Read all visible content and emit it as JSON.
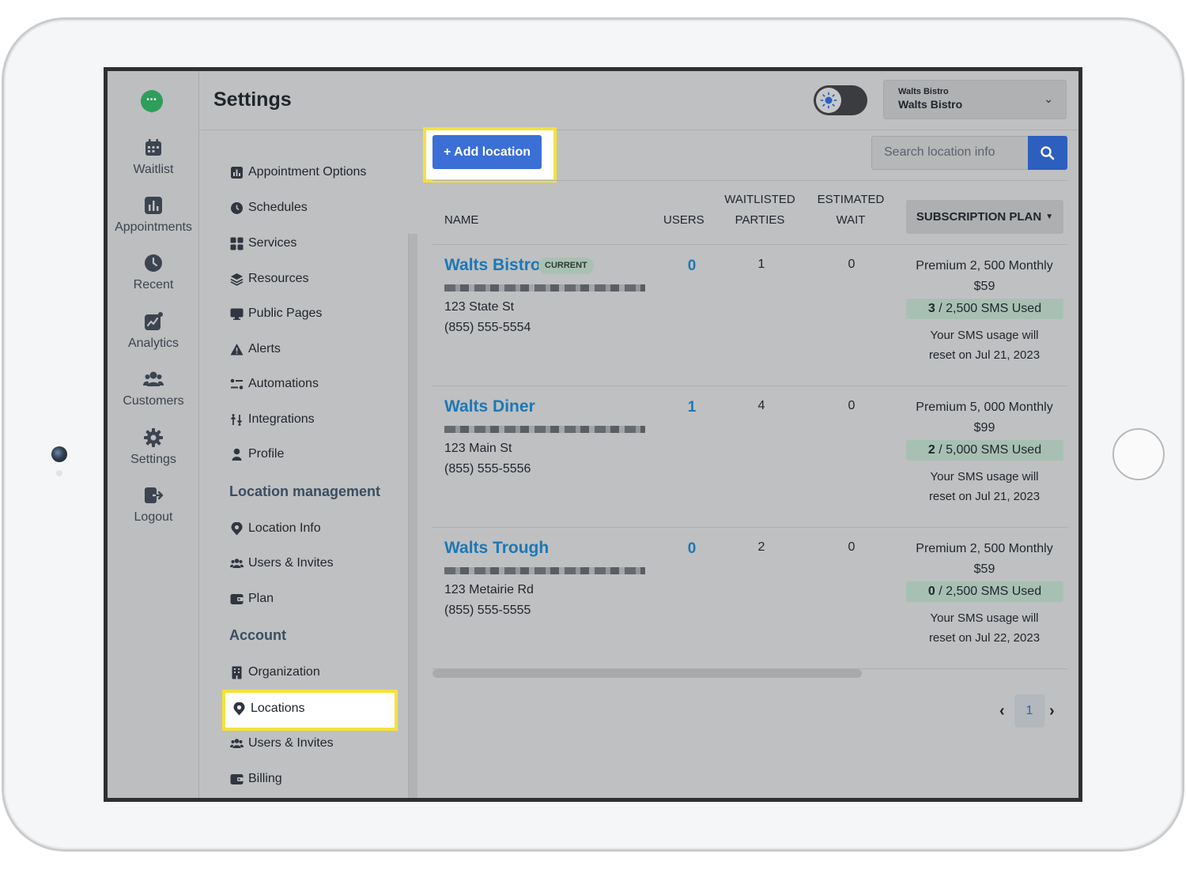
{
  "app": {
    "page_title": "Settings",
    "location_selector": {
      "line1": "Walts Bistro",
      "line2": "Walts Bistro"
    }
  },
  "rail": {
    "items": [
      {
        "label": "Waitlist",
        "icon": "calendar-icon"
      },
      {
        "label": "Appointments",
        "icon": "bar-chart-icon"
      },
      {
        "label": "Recent",
        "icon": "clock-icon"
      },
      {
        "label": "Analytics",
        "icon": "analytics-icon"
      },
      {
        "label": "Customers",
        "icon": "users-icon"
      },
      {
        "label": "Settings",
        "icon": "gear-icon"
      },
      {
        "label": "Logout",
        "icon": "logout-icon"
      }
    ]
  },
  "nav": {
    "items": [
      {
        "label": "Appointment Options",
        "icon": "bar-chart-icon"
      },
      {
        "label": "Schedules",
        "icon": "clock-icon"
      },
      {
        "label": "Services",
        "icon": "grid-icon"
      },
      {
        "label": "Resources",
        "icon": "layers-icon"
      },
      {
        "label": "Public Pages",
        "icon": "monitor-icon"
      },
      {
        "label": "Alerts",
        "icon": "warning-icon"
      },
      {
        "label": "Automations",
        "icon": "automation-icon"
      },
      {
        "label": "Integrations",
        "icon": "integrations-icon"
      },
      {
        "label": "Profile",
        "icon": "user-icon"
      }
    ],
    "location_heading": "Location management",
    "location_items": [
      {
        "label": "Location Info",
        "icon": "location-pin-icon"
      },
      {
        "label": "Users & Invites",
        "icon": "users-icon"
      },
      {
        "label": "Plan",
        "icon": "wallet-icon"
      }
    ],
    "account_heading": "Account",
    "account_items": [
      {
        "label": "Organization",
        "icon": "building-icon"
      },
      {
        "label": "Locations",
        "icon": "location-pin-icon"
      },
      {
        "label": "Users & Invites",
        "icon": "users-icon"
      },
      {
        "label": "Billing",
        "icon": "wallet-icon"
      }
    ]
  },
  "toolbar": {
    "add_location_label": "+ Add location",
    "search_placeholder": "Search location info"
  },
  "table": {
    "headers": {
      "name": "NAME",
      "users": "USERS",
      "waitlisted_1": "WAITLISTED",
      "waitlisted_2": "PARTIES",
      "estimated_1": "ESTIMATED",
      "estimated_2": "WAIT",
      "plan": "SUBSCRIPTION PLAN"
    },
    "rows": [
      {
        "name": "Walts Bistro",
        "badge": "CURRENT",
        "address": "123 State St",
        "phone": "(855) 555-5554",
        "users": "0",
        "parties": "1",
        "wait": "0",
        "plan_line1": "Premium 2, 500 Monthly",
        "plan_line2": "$59",
        "sms_used": "3",
        "sms_total": " / 2,500 SMS Used",
        "reset_line1": "Your SMS usage will",
        "reset_line2": "reset on Jul 21, 2023"
      },
      {
        "name": "Walts Diner",
        "badge": "",
        "address": "123 Main St",
        "phone": "(855) 555-5556",
        "users": "1",
        "parties": "4",
        "wait": "0",
        "plan_line1": "Premium 5, 000 Monthly",
        "plan_line2": "$99",
        "sms_used": "2",
        "sms_total": " / 5,000 SMS Used",
        "reset_line1": "Your SMS usage will",
        "reset_line2": "reset on Jul 21, 2023"
      },
      {
        "name": "Walts Trough",
        "badge": "",
        "address": "123 Metairie Rd",
        "phone": "(855) 555-5555",
        "users": "0",
        "parties": "2",
        "wait": "0",
        "plan_line1": "Premium 2, 500 Monthly",
        "plan_line2": "$59",
        "sms_used": "0",
        "sms_total": " / 2,500 SMS Used",
        "reset_line1": "Your SMS usage will",
        "reset_line2": "reset on Jul 22, 2023"
      }
    ]
  },
  "pager": {
    "prev": "‹",
    "page": "1",
    "next": "›"
  },
  "colors": {
    "accent": "#3b6fd6",
    "link": "#1b78b6",
    "highlight": "#f4e23a",
    "brand": "#2f9e5a"
  }
}
